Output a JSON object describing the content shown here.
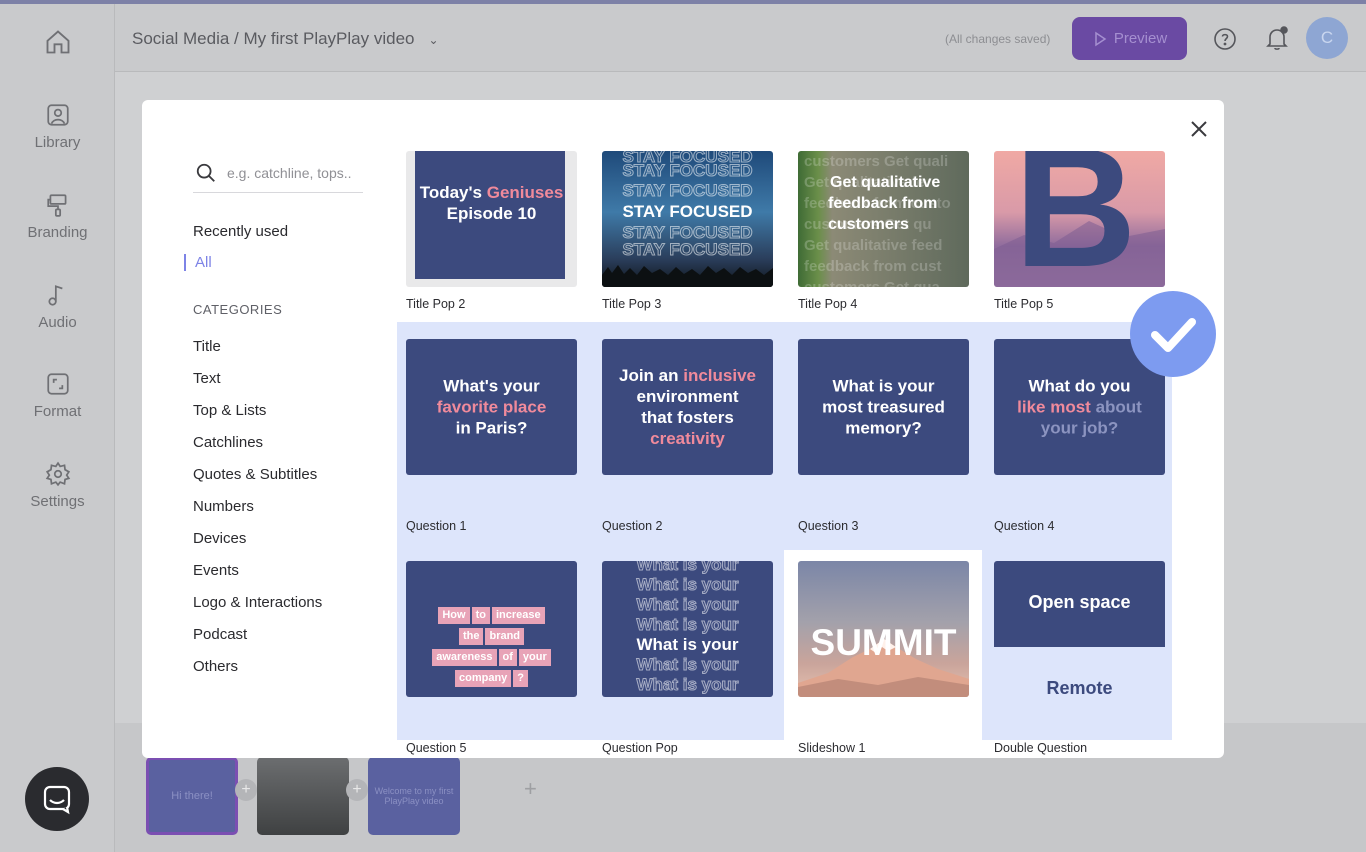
{
  "app": {
    "nav": [
      {
        "label": "Library",
        "icon": "image-icon"
      },
      {
        "label": "Branding",
        "icon": "paint-roller-icon"
      },
      {
        "label": "Audio",
        "icon": "music-note-icon"
      },
      {
        "label": "Format",
        "icon": "resize-icon"
      },
      {
        "label": "Settings",
        "icon": "gear-icon"
      }
    ],
    "breadcrumb": "Social Media / My first PlayPlay video",
    "saved_status": "(All changes saved)",
    "preview_label": "Preview",
    "avatar_initial": "C"
  },
  "timeline": {
    "thumb1_text": "Hi there!",
    "thumb3_text": "Welcome to my first PlayPlay video"
  },
  "modal": {
    "search_placeholder": "e.g. catchline, tops..",
    "recently_used": "Recently used",
    "all": "All",
    "categories_heading": "CATEGORIES",
    "categories": [
      "Title",
      "Text",
      "Top & Lists",
      "Catchlines",
      "Quotes & Subtitles",
      "Numbers",
      "Devices",
      "Events",
      "Logo & Interactions",
      "Podcast",
      "Others"
    ],
    "templates": [
      {
        "name": "Title Pop 2",
        "line1a": "Today's ",
        "line1b": "Geniuses",
        "line2": "Episode 10"
      },
      {
        "name": "Title Pop 3",
        "text": "STAY FOCUSED"
      },
      {
        "name": "Title Pop 4",
        "bg_text": [
          "customers Get quali",
          "Get qualitative fe",
          "feedback from custo",
          "customers Get qu",
          "Get qualitative feed",
          "feedback from cust",
          "customers Get qua"
        ],
        "fg_text": [
          "Get qualitative",
          "feedback from",
          "customers"
        ]
      },
      {
        "name": "Title Pop 5",
        "letter": "B"
      },
      {
        "name": "Question 1",
        "l1": "What's your",
        "l2": "favorite place",
        "l3": "in Paris?"
      },
      {
        "name": "Question 2",
        "l1a": "Join an ",
        "l1b": "inclusive",
        "l2": "environment",
        "l3": "that fosters",
        "l4": "creativity"
      },
      {
        "name": "Question 3",
        "l1": "What is your",
        "l2": "most treasured",
        "l3": "memory?"
      },
      {
        "name": "Question 4",
        "l1": "What do you",
        "l2a": "like most ",
        "l2b": "about",
        "l3": "your job?"
      },
      {
        "name": "Question 5",
        "chips": [
          [
            "How",
            "to",
            "increase"
          ],
          [
            "the",
            "brand"
          ],
          [
            "awareness",
            "of",
            "your"
          ],
          [
            "company",
            "?"
          ]
        ]
      },
      {
        "name": "Question Pop",
        "text": "What is your"
      },
      {
        "name": "Slideshow 1",
        "text": "SUMMIT"
      },
      {
        "name": "Double Question",
        "top": "Open space",
        "bottom": "Remote"
      }
    ]
  },
  "colors": {
    "accent": "#7d83e6",
    "navy_card": "#3c4a7e",
    "pink_highlight": "#f08a9b",
    "selection": "#dde5fb",
    "check_badge": "#7d9bf0"
  }
}
